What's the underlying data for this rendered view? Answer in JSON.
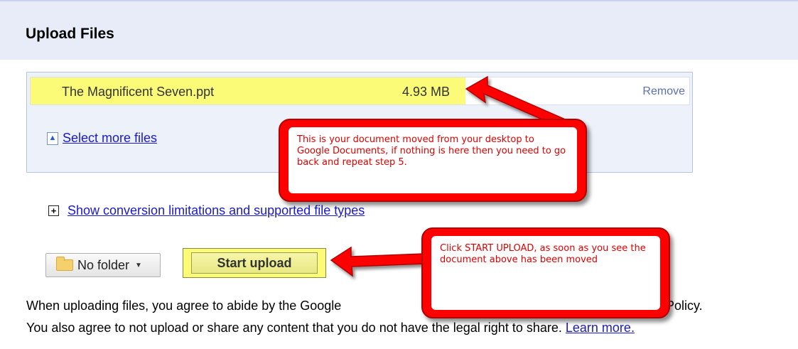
{
  "header": {
    "title": "Upload Files"
  },
  "file_list": {
    "items": [
      {
        "name": "The Magnificent Seven.ppt",
        "size": "4.93 MB",
        "remove_label": "Remove"
      }
    ],
    "select_more_label": "Select more files"
  },
  "conversion": {
    "label": "Show conversion limitations and supported file types"
  },
  "actions": {
    "folder_label": "No folder",
    "start_upload_label": "Start upload"
  },
  "agreement": {
    "line1": "When uploading files, you agree to abide by the Google",
    "line1_end": "y Policy.",
    "line2": "You also agree to not upload or share any content that you do not have the legal right to share.",
    "learn_more": "Learn more."
  },
  "annotations": {
    "callout1": "This is your document moved from your desktop to Google Documents, if nothing is here then you need to go back and repeat step 5.",
    "callout2": "Click START UPLOAD, as soon as you see the document above has been moved"
  },
  "colors": {
    "highlight": "#fbfb78",
    "annotation_red": "#ff0000",
    "link": "#1a1acc",
    "header_bg": "#e8ecf9"
  }
}
